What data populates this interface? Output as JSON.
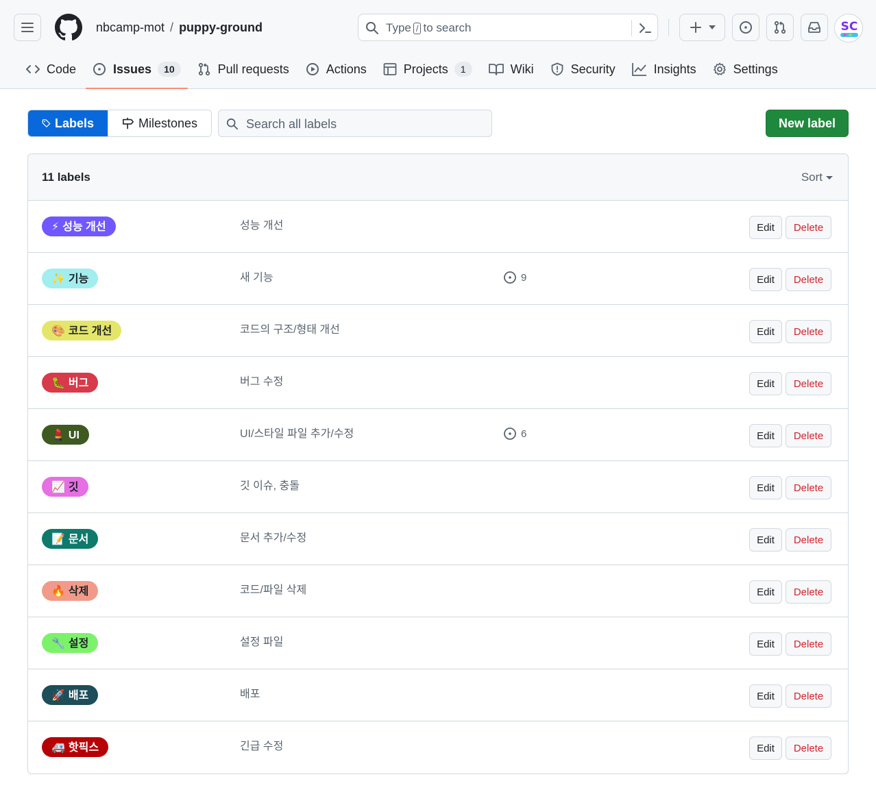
{
  "header": {
    "owner": "nbcamp-mot",
    "separator": "/",
    "repo": "puppy-ground",
    "search": {
      "prefix": "Type",
      "key": "/",
      "suffix": "to search"
    },
    "avatar_text": "SC"
  },
  "tabs": [
    {
      "label": "Code",
      "icon": "code-icon"
    },
    {
      "label": "Issues",
      "icon": "issue-icon",
      "count": "10",
      "active": true
    },
    {
      "label": "Pull requests",
      "icon": "pull-request-icon"
    },
    {
      "label": "Actions",
      "icon": "play-icon"
    },
    {
      "label": "Projects",
      "icon": "table-icon",
      "count": "1"
    },
    {
      "label": "Wiki",
      "icon": "book-icon"
    },
    {
      "label": "Security",
      "icon": "shield-icon"
    },
    {
      "label": "Insights",
      "icon": "graph-icon"
    },
    {
      "label": "Settings",
      "icon": "gear-icon"
    }
  ],
  "subnav": {
    "labels": "Labels",
    "milestones": "Milestones",
    "search_placeholder": "Search all labels",
    "new_label": "New label"
  },
  "box": {
    "count_title": "11 labels",
    "sort": "Sort"
  },
  "actions": {
    "edit": "Edit",
    "delete": "Delete"
  },
  "labels": [
    {
      "emoji": "⚡",
      "name": "성능 개선",
      "description": "성능 개선",
      "issues": "",
      "bg": "#7057ff",
      "fg": "#ffffff"
    },
    {
      "emoji": "✨",
      "name": "기능",
      "description": "새 기능",
      "issues": "9",
      "bg": "#a2eeef",
      "fg": "#1f2328"
    },
    {
      "emoji": "🎨",
      "name": "코드 개선",
      "description": "코드의 구조/형태 개선",
      "issues": "",
      "bg": "#e4e669",
      "fg": "#1f2328"
    },
    {
      "emoji": "🐛",
      "name": "버그",
      "description": "버그 수정",
      "issues": "",
      "bg": "#d73a4a",
      "fg": "#ffffff"
    },
    {
      "emoji": "💄",
      "name": "UI",
      "description": "UI/스타일 파일 추가/수정",
      "issues": "6",
      "bg": "#3e5a21",
      "fg": "#ffffff"
    },
    {
      "emoji": "📈",
      "name": "깃",
      "description": "깃 이슈, 충돌",
      "issues": "",
      "bg": "#e56fe3",
      "fg": "#1f2328"
    },
    {
      "emoji": "📝",
      "name": "문서",
      "description": "문서 추가/수정",
      "issues": "",
      "bg": "#0e7a6b",
      "fg": "#ffffff"
    },
    {
      "emoji": "🔥",
      "name": "삭제",
      "description": "코드/파일 삭제",
      "issues": "",
      "bg": "#f29a8a",
      "fg": "#1f2328"
    },
    {
      "emoji": "🔧",
      "name": "설정",
      "description": "설정 파일",
      "issues": "",
      "bg": "#7cf26b",
      "fg": "#1f2328"
    },
    {
      "emoji": "🚀",
      "name": "배포",
      "description": "배포",
      "issues": "",
      "bg": "#1d4e59",
      "fg": "#ffffff"
    },
    {
      "emoji": "🚑",
      "name": "핫픽스",
      "description": "긴급 수정",
      "issues": "",
      "bg": "#b60205",
      "fg": "#ffffff"
    }
  ]
}
